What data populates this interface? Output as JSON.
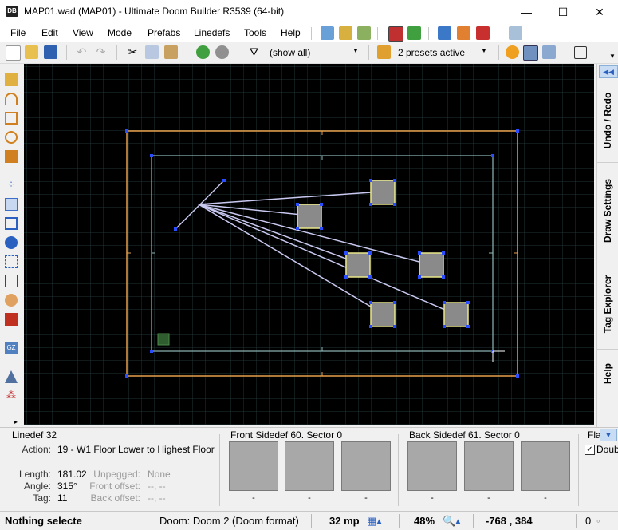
{
  "window": {
    "title": "MAP01.wad (MAP01) - Ultimate Doom Builder R3539 (64-bit)",
    "app_icon": "DB",
    "minimize": "—",
    "maximize": "☐",
    "close": "✕"
  },
  "menu": [
    "File",
    "Edit",
    "View",
    "Mode",
    "Prefabs",
    "Linedefs",
    "Tools",
    "Help"
  ],
  "toolbar": {
    "filter_value": "(show all)",
    "presets_value": "2 presets active"
  },
  "side_tabs": [
    "Undo / Redo",
    "Draw Settings",
    "Tag Explorer",
    "Help"
  ],
  "linedef_info": {
    "title": "Linedef 32",
    "action_label": "Action:",
    "action_value": "19 - W1 Floor Lower to Highest Floor",
    "length_label": "Length:",
    "length_value": "181.02",
    "angle_label": "Angle:",
    "angle_value": "315°",
    "tag_label": "Tag:",
    "tag_value": "11",
    "unpegged_label": "Unpegged:",
    "unpegged_value": "None",
    "front_offset_label": "Front offset:",
    "front_offset_value": "--, --",
    "back_offset_label": "Back offset:",
    "back_offset_value": "--, --"
  },
  "front_sidedef": {
    "title": "Front Sidedef 60.  Sector 0",
    "textures": [
      "-",
      "-",
      "-"
    ]
  },
  "back_sidedef": {
    "title": "Back Sidedef 61.  Sector 0",
    "textures": [
      "-",
      "-",
      "-"
    ]
  },
  "flags": {
    "title": "Fla",
    "checkbox_label": "Doub",
    "checked": true
  },
  "status": {
    "message": "Nothing selecte",
    "game": "Doom: Doom 2 (Doom format)",
    "grid": "32 mp",
    "zoom": "48%",
    "coords": "-768  ,  384",
    "errors": "0"
  },
  "colors": {
    "map_bg": "#000000",
    "grid_line": "#1f3536",
    "sector_outer": "#e8a04c",
    "sector_inner": "#8fb8b8",
    "vertex": "#2a4cff",
    "link_line": "#c8c8f0",
    "thing_fill": "#8a8a8a",
    "thing_border": "#e8e88a"
  }
}
